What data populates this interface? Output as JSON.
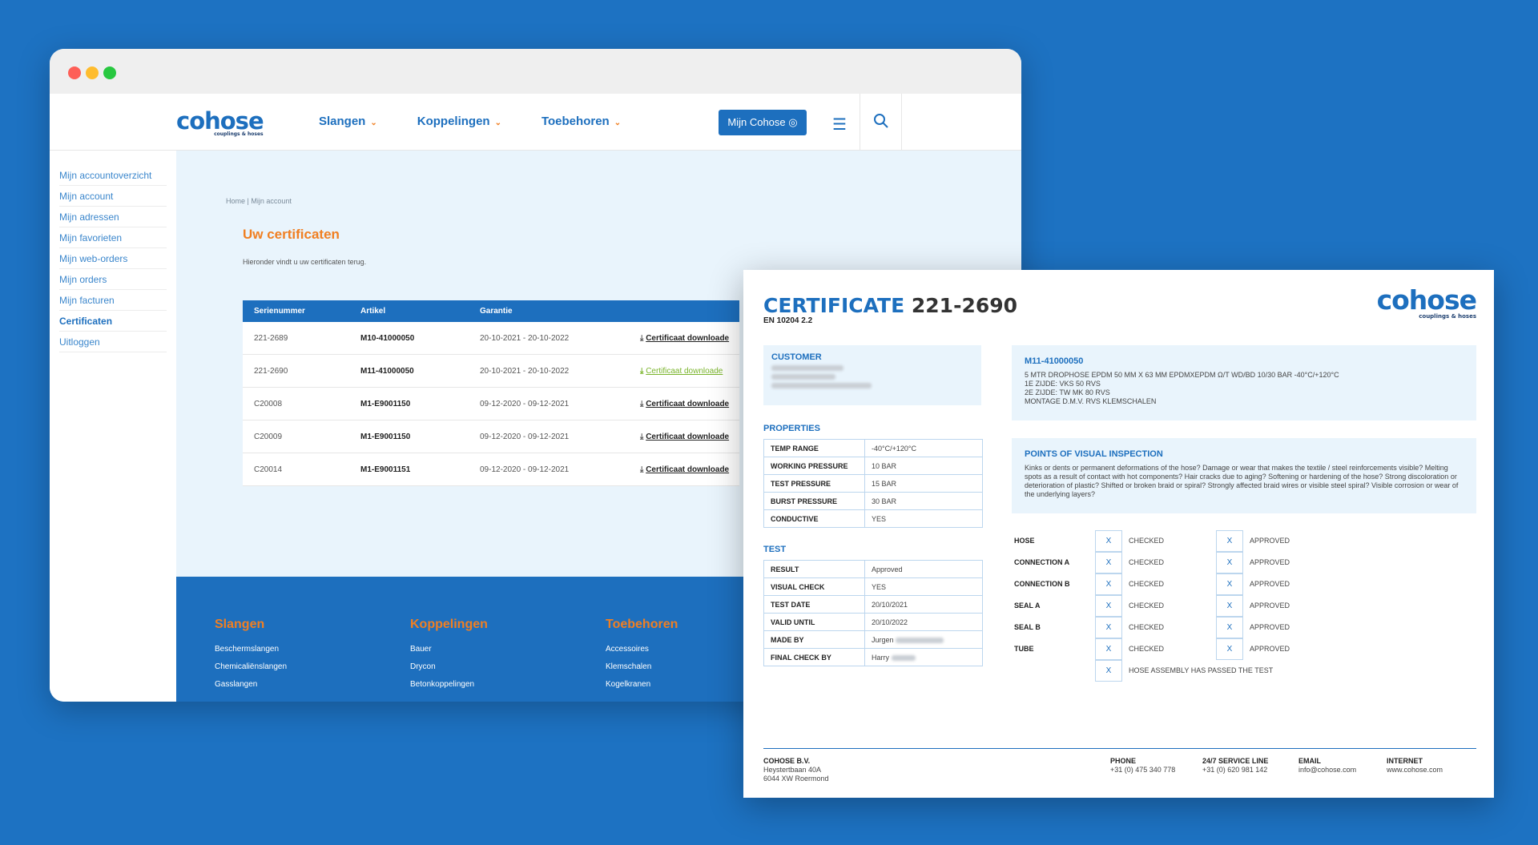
{
  "browser": {
    "logo": {
      "name": "cohose",
      "tagline": "couplings & hoses"
    },
    "nav": [
      {
        "label": "Slangen"
      },
      {
        "label": "Koppelingen"
      },
      {
        "label": "Toebehoren"
      }
    ],
    "mijn_button": "Mijn Cohose ◎",
    "menu_icon": "☰",
    "sidebar": [
      "Mijn accountoverzicht",
      "Mijn account",
      "Mijn adressen",
      "Mijn favorieten",
      "Mijn web-orders",
      "Mijn orders",
      "Mijn facturen",
      "Certificaten",
      "Uitloggen"
    ],
    "breadcrumb": "Home | Mijn account",
    "title": "Uw certificaten",
    "subtitle": "Hieronder vindt u uw certificaten terug.",
    "table": {
      "headers": [
        "Serienummer",
        "Artikel",
        "Garantie",
        ""
      ],
      "rows": [
        {
          "serial": "221-2689",
          "article": "M10-41000050",
          "warranty": "20-10-2021 - 20-10-2022",
          "link": "Certificaat downloade"
        },
        {
          "serial": "221-2690",
          "article": "M11-41000050",
          "warranty": "20-10-2021 - 20-10-2022",
          "link": "Certificaat downloade"
        },
        {
          "serial": "C20008",
          "article": "M1-E9001150",
          "warranty": "09-12-2020 - 09-12-2021",
          "link": "Certificaat downloade"
        },
        {
          "serial": "C20009",
          "article": "M1-E9001150",
          "warranty": "09-12-2020 - 09-12-2021",
          "link": "Certificaat downloade"
        },
        {
          "serial": "C20014",
          "article": "M1-E9001151",
          "warranty": "09-12-2020 - 09-12-2021",
          "link": "Certificaat downloade"
        }
      ]
    },
    "footer": [
      {
        "title": "Slangen",
        "links": [
          "Beschermslangen",
          "Chemicaliënslangen",
          "Gasslangen"
        ]
      },
      {
        "title": "Koppelingen",
        "links": [
          "Bauer",
          "Drycon",
          "Betonkoppelingen"
        ]
      },
      {
        "title": "Toebehoren",
        "links": [
          "Accessoires",
          "Klemschalen",
          "Kogelkranen"
        ]
      }
    ],
    "colors": {
      "brand": "#1d6fbe",
      "accent": "#f07f22",
      "highlight": "#7ab42b"
    }
  },
  "certificate": {
    "title_word": "CERTIFICATE",
    "number": "221-2690",
    "standard": "EN 10204 2.2",
    "customer_label": "CUSTOMER",
    "properties_label": "PROPERTIES",
    "properties": [
      {
        "k": "TEMP RANGE",
        "v": "-40°C/+120°C"
      },
      {
        "k": "WORKING PRESSURE",
        "v": "10 BAR"
      },
      {
        "k": "TEST PRESSURE",
        "v": "15 BAR"
      },
      {
        "k": "BURST PRESSURE",
        "v": "30 BAR"
      },
      {
        "k": "CONDUCTIVE",
        "v": "YES"
      }
    ],
    "test_label": "TEST",
    "test": [
      {
        "k": "RESULT",
        "v": "Approved"
      },
      {
        "k": "VISUAL CHECK",
        "v": "YES"
      },
      {
        "k": "TEST DATE",
        "v": "20/10/2021"
      },
      {
        "k": "VALID UNTIL",
        "v": "20/10/2022"
      },
      {
        "k": "MADE BY",
        "v": "Jurgen"
      },
      {
        "k": "FINAL CHECK BY",
        "v": "Harry"
      }
    ],
    "article": "M11-41000050",
    "article_desc": [
      "5 MTR DROPHOSE EPDM 50 MM X 63 MM EPDMXEPDM Ω/T WD/BD 10/30 BAR -40°C/+120°C",
      "1E ZIJDE: VKS 50 RVS",
      "2E ZIJDE: TW MK 80 RVS",
      "MONTAGE D.M.V. RVS KLEMSCHALEN"
    ],
    "inspection_label": "POINTS OF VISUAL INSPECTION",
    "inspection_text": "Kinks or dents or permanent deformations of the hose? Damage or wear that makes the textile / steel reinforcements visible? Melting spots as a result of contact with hot components? Hair cracks due to aging? Softening or hardening of the hose? Strong discoloration or deterioration of plastic? Shifted or broken braid or spiral? Strongly affected braid wires or visible steel spiral? Visible corrosion or wear of the underlying layers?",
    "checks": [
      {
        "item": "HOSE",
        "mark1": "X",
        "checked": "CHECKED",
        "mark2": "X",
        "approved": "APPROVED"
      },
      {
        "item": "CONNECTION A",
        "mark1": "X",
        "checked": "CHECKED",
        "mark2": "X",
        "approved": "APPROVED"
      },
      {
        "item": "CONNECTION B",
        "mark1": "X",
        "checked": "CHECKED",
        "mark2": "X",
        "approved": "APPROVED"
      },
      {
        "item": "SEAL A",
        "mark1": "X",
        "checked": "CHECKED",
        "mark2": "X",
        "approved": "APPROVED"
      },
      {
        "item": "SEAL B",
        "mark1": "X",
        "checked": "CHECKED",
        "mark2": "X",
        "approved": "APPROVED"
      },
      {
        "item": "TUBE",
        "mark1": "X",
        "checked": "CHECKED",
        "mark2": "X",
        "approved": "APPROVED"
      }
    ],
    "final_mark": "X",
    "final_text": "HOSE ASSEMBLY HAS PASSED THE TEST",
    "footer": {
      "company": "COHOSE B.V.",
      "address1": "Heystertbaan 40A",
      "address2": "6044 XW Roermond",
      "phone_label": "PHONE",
      "phone": "+31 (0) 475 340 778",
      "service_label": "24/7 SERVICE LINE",
      "service": "+31 (0) 620 981 142",
      "email_label": "EMAIL",
      "email": "info@cohose.com",
      "internet_label": "INTERNET",
      "internet": "www.cohose.com"
    }
  }
}
